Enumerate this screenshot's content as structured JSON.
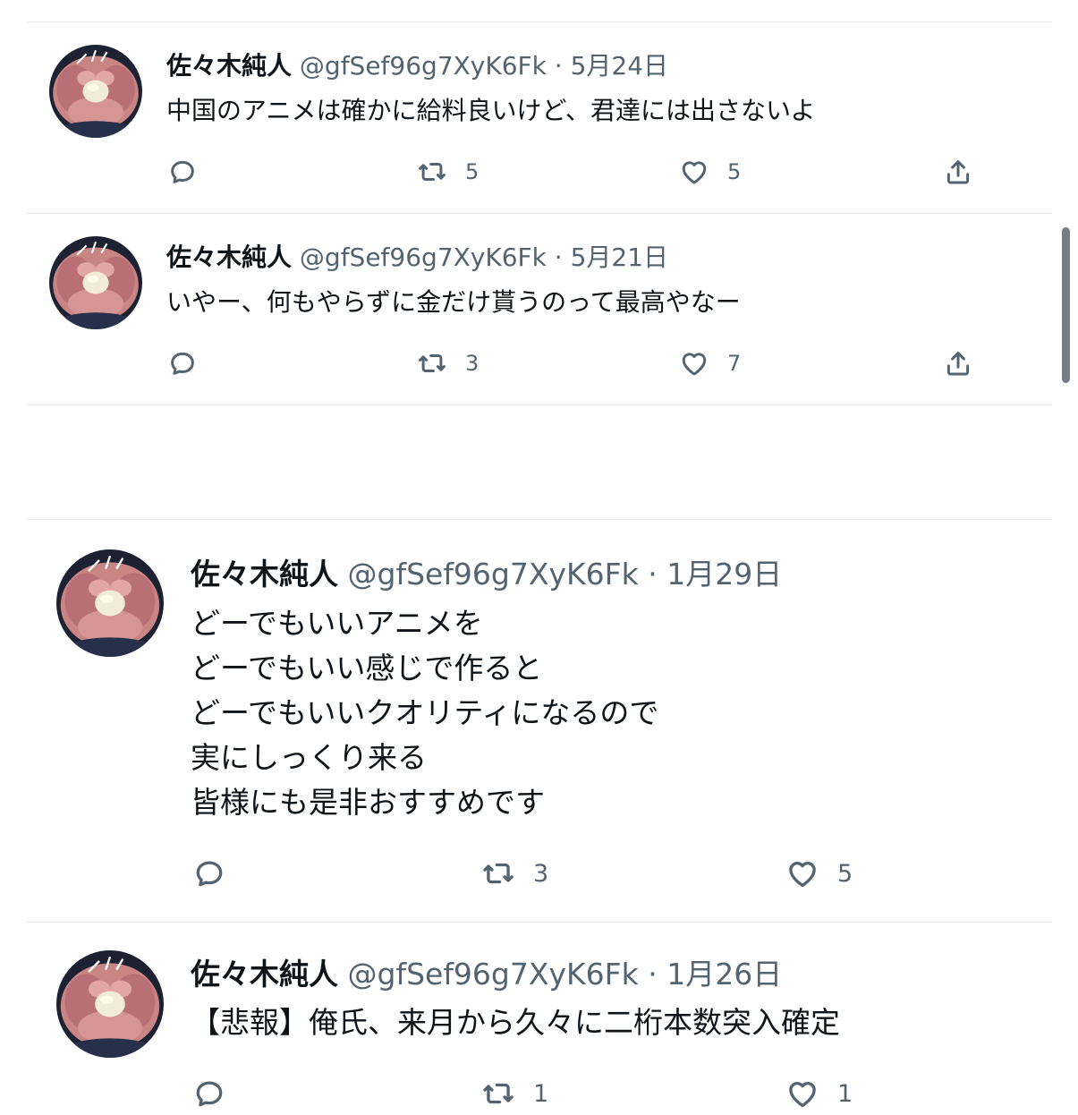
{
  "tweets": [
    {
      "name": "佐々木純人",
      "handle": "@gfSef96g7XyK6Fk",
      "separator": "·",
      "date": "5月24日",
      "text": "中国のアニメは確かに給料良いけど、君達には出さないよ",
      "retweets": "5",
      "likes": "5"
    },
    {
      "name": "佐々木純人",
      "handle": "@gfSef96g7XyK6Fk",
      "separator": "·",
      "date": "5月21日",
      "text": "いやー、何もやらずに金だけ貰うのって最高やなー",
      "retweets": "3",
      "likes": "7"
    },
    {
      "name": "佐々木純人",
      "handle": "@gfSef96g7XyK6Fk",
      "separator": "·",
      "date": "1月29日",
      "text": "どーでもいいアニメを\nどーでもいい感じで作ると\nどーでもいいクオリティになるので\n実にしっくり来る\n皆様にも是非おすすめです",
      "retweets": "3",
      "likes": "5"
    },
    {
      "name": "佐々木純人",
      "handle": "@gfSef96g7XyK6Fk",
      "separator": "·",
      "date": "1月26日",
      "text": "【悲報】俺氏、来月から久々に二桁本数突入確定",
      "retweets": "1",
      "likes": "1"
    }
  ],
  "icons": {
    "reply": "reply-icon",
    "retweet": "retweet-icon",
    "like": "heart-icon",
    "share": "share-icon"
  },
  "colors": {
    "text": "#0f1419",
    "secondary": "#536471",
    "divider": "#e6ecf0",
    "scrollbar": "#777d82"
  }
}
